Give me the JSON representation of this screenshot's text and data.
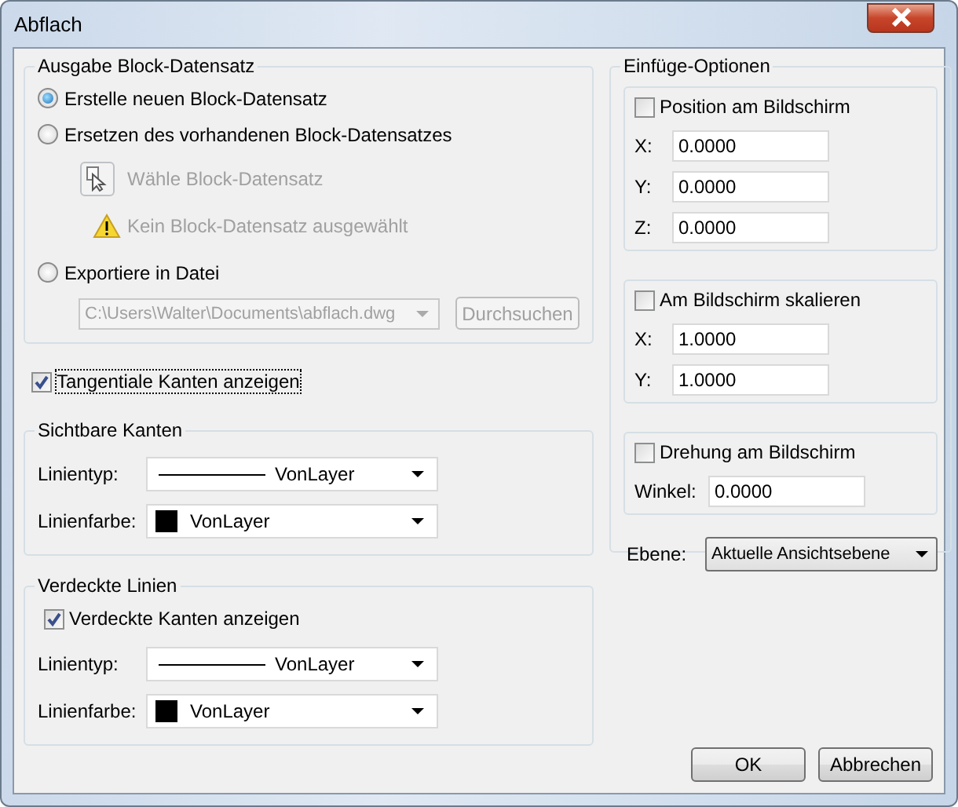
{
  "window": {
    "title": "Abflach"
  },
  "output_group": {
    "title": "Ausgabe Block-Datensatz",
    "options": [
      {
        "label": "Erstelle neuen Block-Datensatz",
        "selected": true
      },
      {
        "label": "Ersetzen des vorhandenen Block-Datensatzes",
        "selected": false
      },
      {
        "label": "Exportiere in Datei",
        "selected": false
      }
    ],
    "pick_button": {
      "label": "Wähle Block-Datensatz",
      "disabled": true
    },
    "warning": {
      "text": "Kein Block-Datensatz ausgewählt",
      "disabled": true
    },
    "path": {
      "value": "C:\\Users\\Walter\\Documents\\abflach.dwg",
      "disabled": true
    },
    "browse_button": {
      "label": "Durchsuchen",
      "disabled": true
    }
  },
  "tangent_edges": {
    "label": "Tangentiale Kanten anzeigen",
    "checked": true
  },
  "visible_edges": {
    "title": "Sichtbare Kanten",
    "rows": [
      {
        "label": "Linientyp:",
        "kind": "linetype",
        "value": "VonLayer"
      },
      {
        "label": "Linienfarbe:",
        "kind": "color",
        "value": "VonLayer"
      }
    ]
  },
  "hidden_lines": {
    "title": "Verdeckte Linien",
    "checkbox": {
      "label": "Verdeckte Kanten anzeigen",
      "checked": true
    },
    "rows": [
      {
        "label": "Linientyp:",
        "kind": "linetype",
        "value": "VonLayer"
      },
      {
        "label": "Linienfarbe:",
        "kind": "color",
        "value": "VonLayer"
      }
    ]
  },
  "insert_options": {
    "title": "Einfüge-Optionen",
    "sections": [
      {
        "label": "Position am Bildschirm",
        "checked": false,
        "fields": [
          {
            "label": "X:",
            "value": "0.0000"
          },
          {
            "label": "Y:",
            "value": "0.0000"
          },
          {
            "label": "Z:",
            "value": "0.0000"
          }
        ]
      },
      {
        "label": "Am Bildschirm skalieren",
        "checked": false,
        "fields": [
          {
            "label": "X:",
            "value": "1.0000"
          },
          {
            "label": "Y:",
            "value": "1.0000"
          }
        ]
      },
      {
        "label": "Drehung am Bildschirm",
        "checked": false,
        "fields": [
          {
            "label": "Winkel:",
            "value": "0.0000"
          }
        ]
      }
    ],
    "layer": {
      "label": "Ebene:",
      "value": "Aktuelle Ansichtsebene"
    }
  },
  "buttons": [
    "OK",
    "Abbrechen"
  ]
}
